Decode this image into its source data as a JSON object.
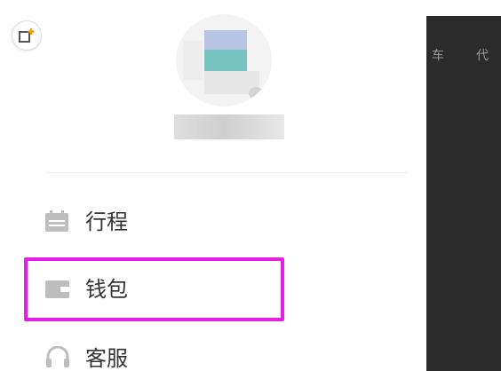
{
  "header_icon": "add-to-home-icon",
  "overlay": {
    "peek_text_1": "车",
    "peek_text_2": "代"
  },
  "menu": {
    "items": [
      {
        "label": "行程",
        "icon": "calendar-icon"
      },
      {
        "label": "钱包",
        "icon": "wallet-icon"
      },
      {
        "label": "客服",
        "icon": "headset-icon"
      }
    ]
  },
  "colors": {
    "highlight": "#e31fe8",
    "overlay": "#2b2b2b",
    "accent_icon": "#f39c12"
  }
}
